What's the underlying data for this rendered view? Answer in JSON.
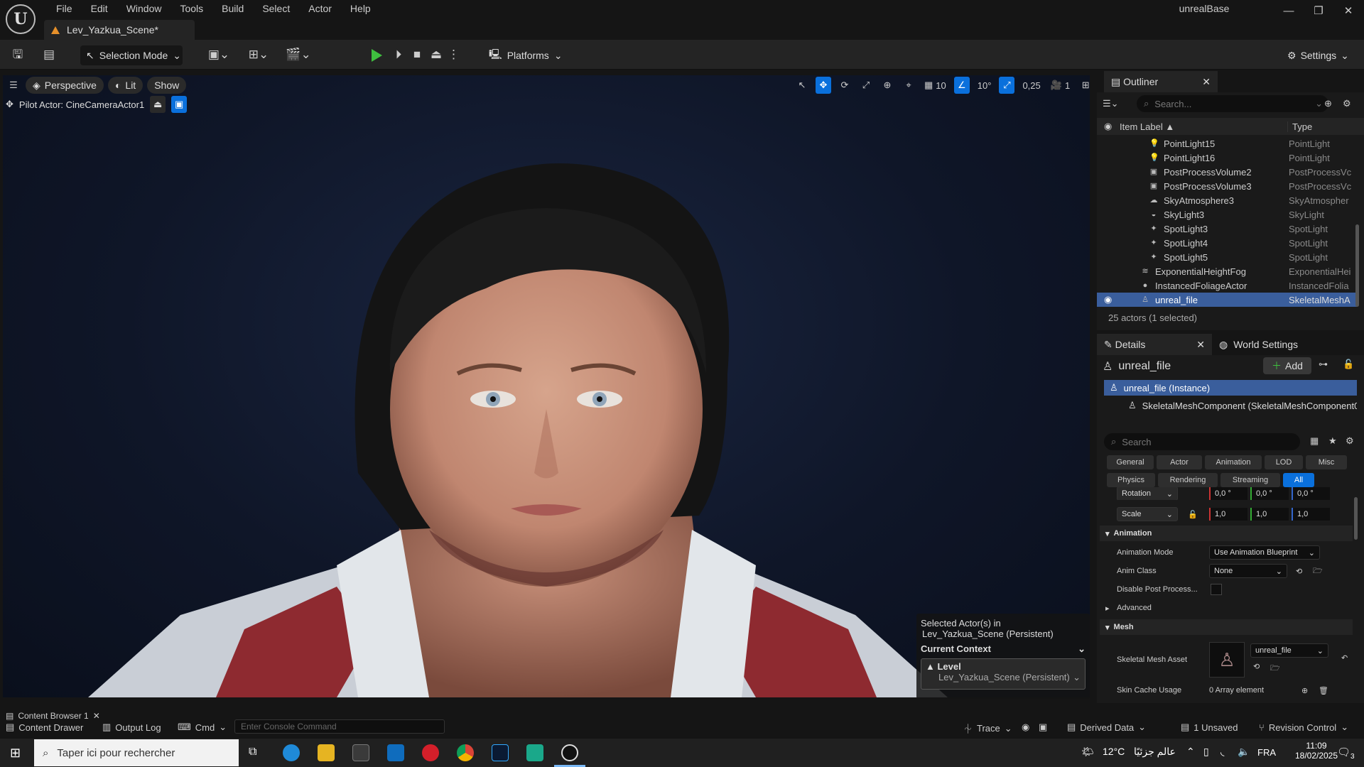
{
  "window": {
    "app_name": "unrealBase",
    "menu": [
      "File",
      "Edit",
      "Window",
      "Tools",
      "Build",
      "Select",
      "Actor",
      "Help"
    ],
    "level_tab": "Lev_Yazkua_Scene*",
    "logo_glyph": "U"
  },
  "toolbar": {
    "selection_mode": "Selection Mode",
    "platforms": "Platforms",
    "settings": "Settings"
  },
  "viewport": {
    "perspective": "Perspective",
    "lit": "Lit",
    "show": "Show",
    "pilot_actor": "Pilot Actor: CineCameraActor1",
    "grid_size": "10",
    "angle_snap": "10°",
    "scale_snap": "0,25",
    "camera_speed": "1",
    "context": {
      "selected_line1": "Selected Actor(s) in",
      "selected_line2": "Lev_Yazkua_Scene (Persistent)",
      "current_context": "Current Context",
      "level_label": "Level",
      "level_value": "Lev_Yazkua_Scene (Persistent)"
    }
  },
  "outliner": {
    "tab": "Outliner",
    "search_placeholder": "Search...",
    "col_label": "Item Label ▲",
    "col_type": "Type",
    "rows": [
      {
        "label": "PointLight15",
        "type": "PointLight",
        "indent": 2,
        "icon": "bulb-icon"
      },
      {
        "label": "PointLight16",
        "type": "PointLight",
        "indent": 2,
        "icon": "bulb-icon"
      },
      {
        "label": "PostProcessVolume2",
        "type": "PostProcessVc",
        "indent": 2,
        "icon": "cube-icon"
      },
      {
        "label": "PostProcessVolume3",
        "type": "PostProcessVc",
        "indent": 2,
        "icon": "cube-icon"
      },
      {
        "label": "SkyAtmosphere3",
        "type": "SkyAtmospher",
        "indent": 2,
        "icon": "sky-icon"
      },
      {
        "label": "SkyLight3",
        "type": "SkyLight",
        "indent": 2,
        "icon": "skylight-icon"
      },
      {
        "label": "SpotLight3",
        "type": "SpotLight",
        "indent": 2,
        "icon": "spotlight-icon"
      },
      {
        "label": "SpotLight4",
        "type": "SpotLight",
        "indent": 2,
        "icon": "spotlight-icon"
      },
      {
        "label": "SpotLight5",
        "type": "SpotLight",
        "indent": 2,
        "icon": "spotlight-icon"
      },
      {
        "label": "ExponentialHeightFog",
        "type": "ExponentialHei",
        "indent": 1,
        "icon": "fog-icon"
      },
      {
        "label": "InstancedFoliageActor",
        "type": "InstancedFolia",
        "indent": 1,
        "icon": "sphere-icon"
      },
      {
        "label": "unreal_file",
        "type": "SkeletalMeshA",
        "indent": 1,
        "icon": "skeleton-icon",
        "selected": true
      }
    ],
    "count": "25 actors (1 selected)"
  },
  "details": {
    "tab": "Details",
    "world_tab": "World Settings",
    "actor_name": "unreal_file",
    "add": "Add",
    "instance": "unreal_file (Instance)",
    "component": "SkeletalMeshComponent (SkeletalMeshComponent0",
    "search_placeholder": "Search",
    "filters_row1": [
      "General",
      "Actor",
      "Animation",
      "LOD",
      "Misc"
    ],
    "filters_row2": [
      "Physics",
      "Rendering",
      "Streaming",
      "All"
    ],
    "rotation_label": "Rotation",
    "rotation": [
      "0,0 °",
      "0,0 °",
      "0,0 °"
    ],
    "scale_label": "Scale",
    "scale": [
      "1,0",
      "1,0",
      "1,0"
    ],
    "animation_section": "Animation",
    "animation_mode_label": "Animation Mode",
    "animation_mode": "Use Animation Blueprint",
    "anim_class_label": "Anim Class",
    "anim_class": "None",
    "disable_pp_label": "Disable Post Process...",
    "advanced": "Advanced",
    "mesh_section": "Mesh",
    "skeletal_mesh_label": "Skeletal Mesh Asset",
    "skeletal_mesh": "unreal_file",
    "skin_cache_label": "Skin Cache Usage",
    "skin_cache": "0 Array element"
  },
  "statusbar": {
    "content_browser": "Content Browser 1",
    "content_drawer": "Content Drawer",
    "output_log": "Output Log",
    "cmd": "Cmd",
    "console_placeholder": "Enter Console Command",
    "trace": "Trace",
    "derived_data": "Derived Data",
    "unsaved": "1 Unsaved",
    "revision_control": "Revision Control"
  },
  "taskbar": {
    "search": "Taper ici pour rechercher",
    "weather": "12°C",
    "weather_label": "عالم جزئيًا",
    "lang": "FRA",
    "time": "11:09",
    "date": "18/02/2025",
    "notifications": "3"
  },
  "colors": {
    "accent": "#0a70dc",
    "selected_row": "#3a5e9c",
    "play_green": "#3fbf3f",
    "level_icon": "#e6902a"
  }
}
